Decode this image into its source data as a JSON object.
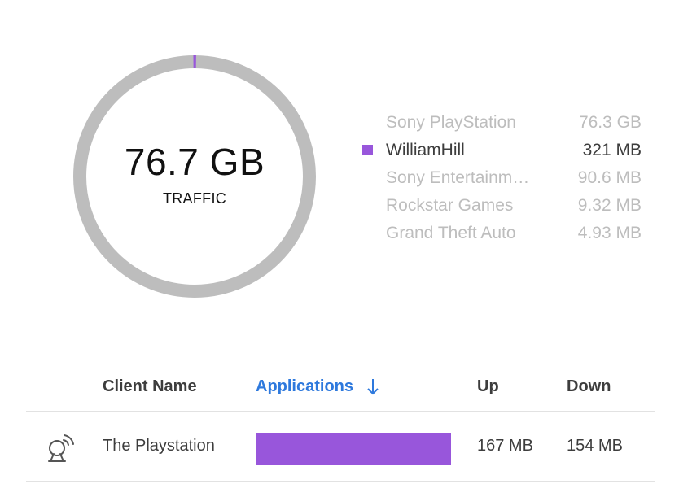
{
  "summary": {
    "total_value": "76.7 GB",
    "total_label": "TRAFFIC",
    "highlight_fraction": 0.0041,
    "ring_color": "#bdbdbd",
    "highlight_color": "#9856db"
  },
  "legend": [
    {
      "name": "Sony PlayStation",
      "value": "76.3 GB",
      "active": false
    },
    {
      "name": "WilliamHill",
      "value": "321 MB",
      "active": true,
      "color": "#9856db"
    },
    {
      "name": "Sony Entertainm…",
      "value": "90.6 MB",
      "active": false
    },
    {
      "name": "Rockstar Games",
      "value": "9.32 MB",
      "active": false
    },
    {
      "name": "Grand Theft Auto",
      "value": "4.93 MB",
      "active": false
    }
  ],
  "table": {
    "headers": {
      "client": "Client Name",
      "applications": "Applications",
      "up": "Up",
      "down": "Down"
    },
    "sort_icon": "arrow-down-icon",
    "rows": [
      {
        "icon": "wireless-client-icon",
        "client": "The Playstation",
        "app_fraction": 1.0,
        "app_color": "#9856db",
        "up": "167 MB",
        "down": "154 MB"
      }
    ]
  }
}
